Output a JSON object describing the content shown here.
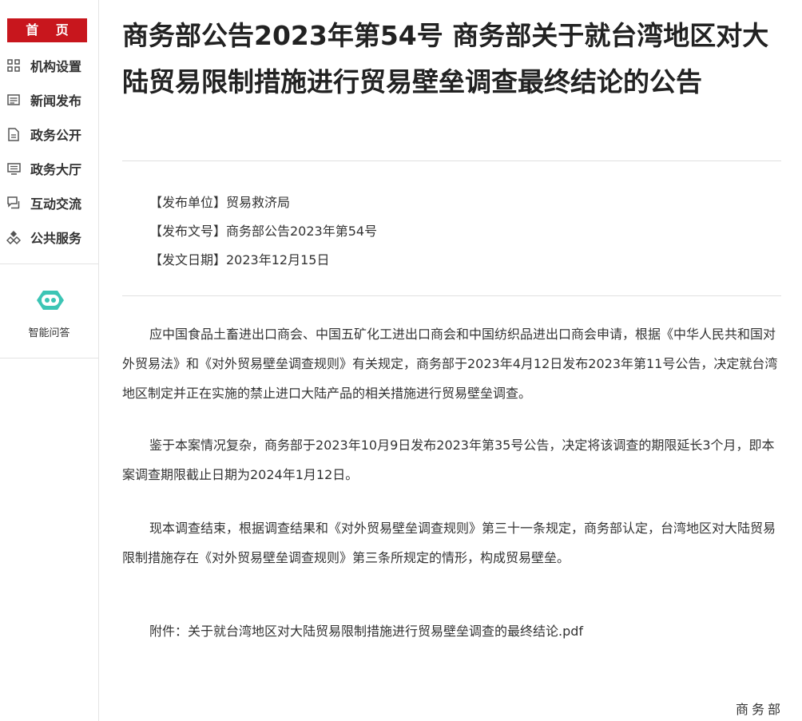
{
  "sidebar": {
    "home_label": "首 页",
    "items": [
      {
        "label": "机构设置",
        "icon": "grid-icon"
      },
      {
        "label": "新闻发布",
        "icon": "newspaper-icon"
      },
      {
        "label": "政务公开",
        "icon": "document-icon"
      },
      {
        "label": "政务大厅",
        "icon": "monitor-icon"
      },
      {
        "label": "互动交流",
        "icon": "chat-icon"
      },
      {
        "label": "公共服务",
        "icon": "service-icon"
      }
    ],
    "assistant_label": "智能问答"
  },
  "article": {
    "title": "商务部公告2023年第54号 商务部关于就台湾地区对大陆贸易限制措施进行贸易壁垒调查最终结论的公告",
    "meta": {
      "unit": "【发布单位】贸易救济局",
      "doc_no": "【发布文号】商务部公告2023年第54号",
      "date": "【发文日期】2023年12月15日"
    },
    "paragraphs": [
      "应中国食品土畜进出口商会、中国五矿化工进出口商会和中国纺织品进出口商会申请，根据《中华人民共和国对外贸易法》和《对外贸易壁垒调查规则》有关规定，商务部于2023年4月12日发布2023年第11号公告，决定就台湾地区制定并正在实施的禁止进口大陆产品的相关措施进行贸易壁垒调查。",
      "鉴于本案情况复杂，商务部于2023年10月9日发布2023年第35号公告，决定将该调查的期限延长3个月，即本案调查期限截止日期为2024年1月12日。",
      "现本调查结束，根据调查结果和《对外贸易壁垒调查规则》第三十一条规定，商务部认定，台湾地区对大陆贸易限制措施存在《对外贸易壁垒调查规则》第三条所规定的情形，构成贸易壁垒。"
    ],
    "attachment": "附件：关于就台湾地区对大陆贸易限制措施进行贸易壁垒调查的最终结论.pdf",
    "signature": "商务部"
  },
  "colors": {
    "brand_red": "#c8161d",
    "robot_teal": "#3cc5b5"
  }
}
